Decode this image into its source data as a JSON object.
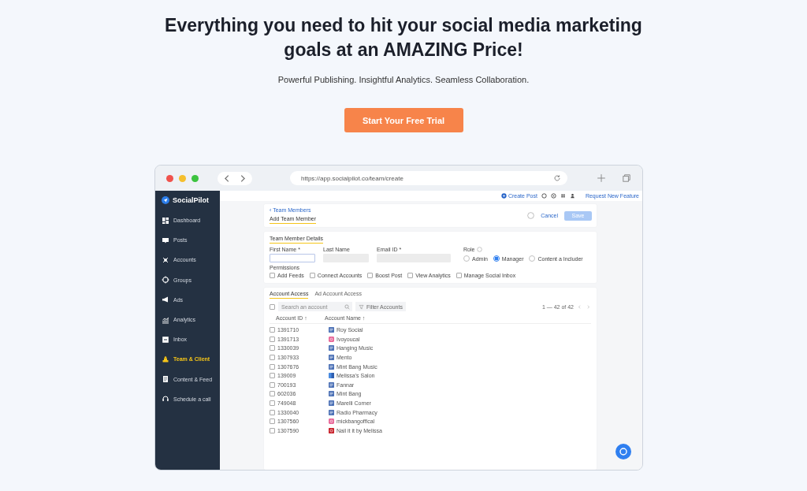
{
  "hero": {
    "title": "Everything you need to hit your social media marketing goals at an AMAZING Price!",
    "subtitle": "Powerful Publishing. Insightful Analytics. Seamless Collaboration.",
    "cta": "Start Your Free Trial"
  },
  "browser": {
    "url": "https://app.socialpilot.co/team/create"
  },
  "app": {
    "logo": "SocialPilot",
    "sidebar": [
      {
        "label": "Dashboard",
        "selected": false
      },
      {
        "label": "Posts",
        "selected": false
      },
      {
        "label": "Accounts",
        "selected": false
      },
      {
        "label": "Groups",
        "selected": false
      },
      {
        "label": "Ads",
        "selected": false
      },
      {
        "label": "Analytics",
        "selected": false
      },
      {
        "label": "Inbox",
        "selected": false
      },
      {
        "label": "Team & Client",
        "selected": true
      },
      {
        "label": "Content & Feed",
        "selected": false
      },
      {
        "label": "Schedule a call",
        "selected": false
      }
    ],
    "topbar": {
      "create_post": "Create Post",
      "request": "Request New Feature"
    },
    "header": {
      "breadcrumb": "‹ Team Members",
      "title": "Add Team Member",
      "cancel": "Cancel",
      "save": {
        "label": "Save",
        "disabled": true
      }
    },
    "details": {
      "title": "Team Member Details",
      "fields": [
        {
          "label": "First Name *",
          "disabled": false
        },
        {
          "label": "Last Name",
          "disabled": true
        },
        {
          "label": "Email ID *",
          "disabled": true
        }
      ],
      "role_label": "Role",
      "roles": [
        {
          "label": "Admin",
          "selected": false
        },
        {
          "label": "Manager",
          "selected": true
        },
        {
          "label": "Content a Includer",
          "selected": false
        }
      ],
      "permissions_label": "Permissions",
      "permissions": [
        {
          "label": "Add Feeds",
          "checked": false
        },
        {
          "label": "Connect Accounts",
          "checked": false
        },
        {
          "label": "Boost Post",
          "checked": false
        },
        {
          "label": "View Analytics",
          "checked": false
        },
        {
          "label": "Manage Social Inbox",
          "checked": false
        }
      ]
    },
    "access": {
      "tabs": [
        {
          "label": "Account Access",
          "selected": true
        },
        {
          "label": "Ad Account Access",
          "selected": false
        }
      ],
      "select_all": {
        "checked": false
      },
      "search": {
        "placeholder": "Search an account"
      },
      "filter": "Filter Accounts",
      "pagination": "1 — 42 of 42",
      "columns": [
        "Account ID ↑",
        "Account Name ↑"
      ],
      "rows": [
        {
          "id": "1391710",
          "name": "Roy Social",
          "kind": "facebook",
          "checked": false
        },
        {
          "id": "1391713",
          "name": "Ivoyoucal",
          "kind": "instagram",
          "checked": false
        },
        {
          "id": "1330039",
          "name": "Hanging Music",
          "kind": "facebook",
          "checked": false
        },
        {
          "id": "1307933",
          "name": "Mento",
          "kind": "facebook",
          "checked": false
        },
        {
          "id": "1307676",
          "name": "Mint Bang Music",
          "kind": "facebook",
          "checked": false
        },
        {
          "id": "139009",
          "name": "Melissa's Salon",
          "kind": "page",
          "checked": false
        },
        {
          "id": "700193",
          "name": "Fannar",
          "kind": "facebook",
          "checked": false
        },
        {
          "id": "602036",
          "name": "Mint Bang",
          "kind": "facebook",
          "checked": false
        },
        {
          "id": "749048",
          "name": "Marelli Corner",
          "kind": "facebook",
          "checked": false
        },
        {
          "id": "1330040",
          "name": "Radio Pharmacy",
          "kind": "facebook",
          "checked": false
        },
        {
          "id": "1307560",
          "name": "mickbangoffical",
          "kind": "instagram",
          "checked": false
        },
        {
          "id": "1307590",
          "name": "Nail it it by Melissa",
          "kind": "pinterest",
          "checked": false
        }
      ]
    }
  }
}
